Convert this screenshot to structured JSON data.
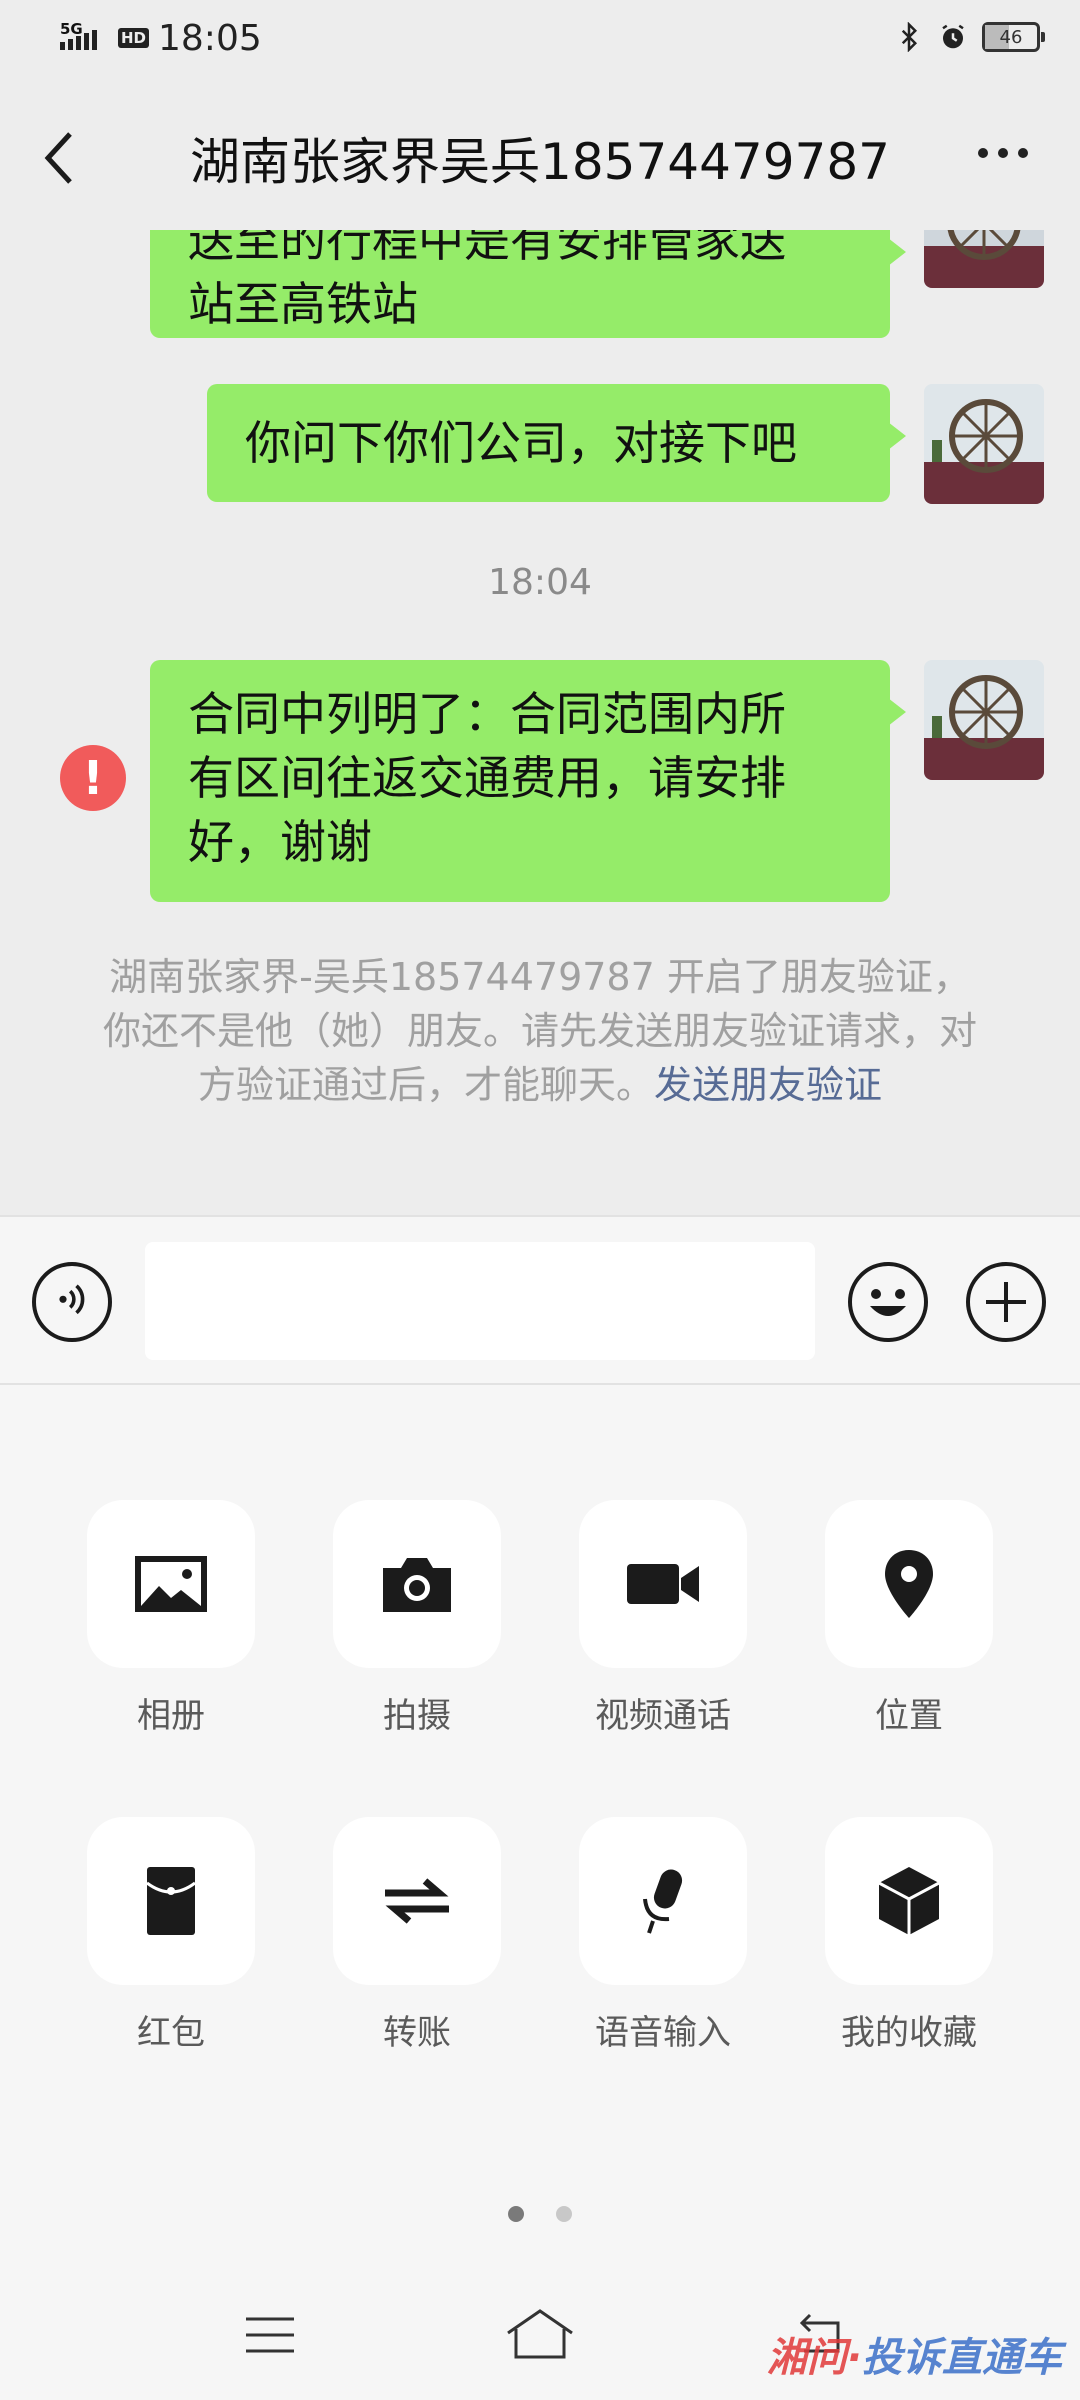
{
  "status_bar": {
    "network": "5G",
    "hd": "HD",
    "time": "18:05",
    "battery": "46"
  },
  "header": {
    "title": "湖南张家界吴兵18574479787"
  },
  "messages": [
    {
      "line1": "送至的行程中是有安排管家送",
      "line2": "站至高铁站"
    },
    {
      "text": "你问下你们公司，对接下吧"
    }
  ],
  "timestamp": "18:04",
  "failed_message": {
    "line1": "合同中列明了：合同范围内所",
    "line2": "有区间往返交通费用，请安排",
    "line3": "好，谢谢",
    "error_mark": "!"
  },
  "system_notice": {
    "text": "湖南张家界-吴兵18574479787 开启了朋友验证，你还不是他（她）朋友。请先发送朋友验证请求，对方验证通过后，才能聊天。",
    "link": "发送朋友验证"
  },
  "input": {
    "value": ""
  },
  "tools": [
    {
      "label": "相册",
      "icon": "album-icon"
    },
    {
      "label": "拍摄",
      "icon": "camera-icon"
    },
    {
      "label": "视频通话",
      "icon": "video-call-icon"
    },
    {
      "label": "位置",
      "icon": "location-icon"
    },
    {
      "label": "红包",
      "icon": "red-packet-icon"
    },
    {
      "label": "转账",
      "icon": "transfer-icon"
    },
    {
      "label": "语音输入",
      "icon": "microphone-icon"
    },
    {
      "label": "我的收藏",
      "icon": "favorites-icon"
    }
  ],
  "pager": {
    "current": 1,
    "total": 2
  },
  "watermark": {
    "part1": "湘问·",
    "part2": "投诉直通车"
  },
  "colors": {
    "bubble": "#95ec69",
    "link": "#576b95",
    "error": "#f15b5b"
  }
}
